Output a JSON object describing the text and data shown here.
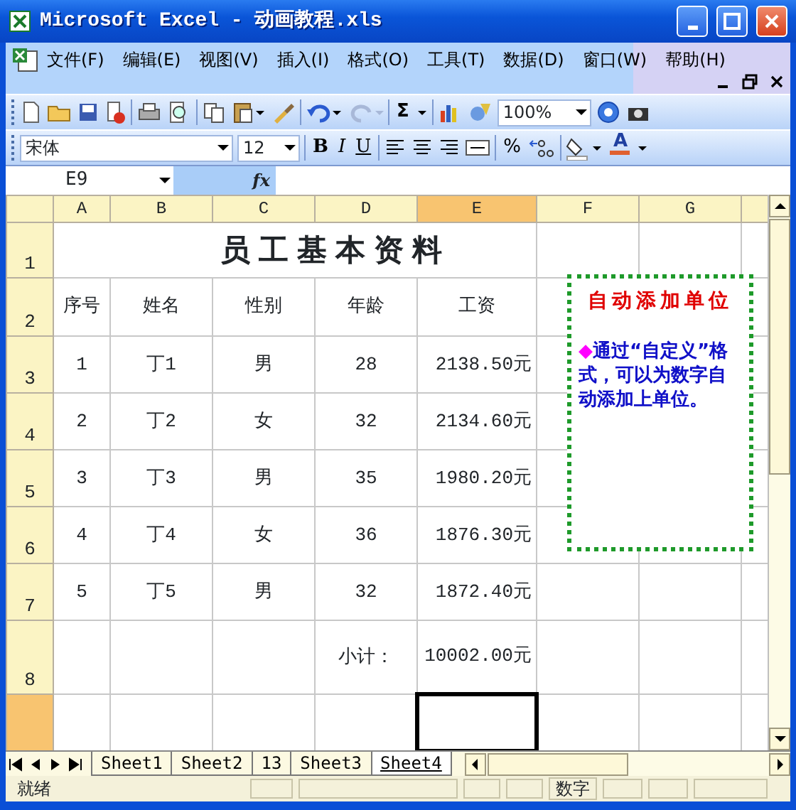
{
  "window": {
    "title": "Microsoft Excel - 动画教程.xls"
  },
  "menu": [
    "文件(F)",
    "编辑(E)",
    "视图(V)",
    "插入(I)",
    "格式(O)",
    "工具(T)",
    "数据(D)",
    "窗口(W)",
    "帮助(H)"
  ],
  "standard_toolbar": {
    "sum": "Σ",
    "zoom": "100%"
  },
  "format_toolbar": {
    "font": "宋体",
    "size": "12",
    "bold": "B",
    "italic": "I",
    "underline": "U",
    "percent": "%",
    "font_color": "A"
  },
  "formula_bar": {
    "name_box": "E9",
    "fx": "fx"
  },
  "sheet": {
    "columns": [
      {
        "label": "A",
        "selected": false
      },
      {
        "label": "B",
        "selected": false
      },
      {
        "label": "C",
        "selected": false
      },
      {
        "label": "D",
        "selected": false
      },
      {
        "label": "E",
        "selected": true
      },
      {
        "label": "F",
        "selected": false
      },
      {
        "label": "G",
        "selected": false
      }
    ],
    "rows": [
      {
        "kind": "title",
        "header": "1",
        "selected": false,
        "text": "员工基本资料"
      },
      {
        "kind": "data",
        "header": "2",
        "selected": false,
        "cells": [
          "序号",
          "姓名",
          "性别",
          "年龄",
          "工资"
        ]
      },
      {
        "kind": "data",
        "header": "3",
        "selected": false,
        "cells": [
          "1",
          "丁1",
          "男",
          "28",
          "2138.50元"
        ]
      },
      {
        "kind": "data",
        "header": "4",
        "selected": false,
        "cells": [
          "2",
          "丁2",
          "女",
          "32",
          "2134.60元"
        ]
      },
      {
        "kind": "data",
        "header": "5",
        "selected": false,
        "cells": [
          "3",
          "丁3",
          "男",
          "35",
          "1980.20元"
        ]
      },
      {
        "kind": "data",
        "header": "6",
        "selected": false,
        "cells": [
          "4",
          "丁4",
          "女",
          "36",
          "1876.30元"
        ]
      },
      {
        "kind": "data",
        "header": "7",
        "selected": false,
        "cells": [
          "5",
          "丁5",
          "男",
          "32",
          "1872.40元"
        ]
      },
      {
        "kind": "total",
        "header": "8",
        "selected": false,
        "label": "小计：",
        "value": "10002.00元"
      },
      {
        "kind": "blank",
        "selected": true
      }
    ]
  },
  "note": {
    "title": "自动添加单位",
    "bullet": "◆",
    "text": "通过“自定义”格式，可以为数字自动添加上单位。"
  },
  "sheet_tabs": [
    {
      "label": "Sheet1",
      "selected": false
    },
    {
      "label": "Sheet2",
      "selected": false
    },
    {
      "label": "13",
      "selected": false
    },
    {
      "label": "Sheet3",
      "selected": false
    },
    {
      "label": "Sheet4",
      "selected": true
    }
  ],
  "status_bar": {
    "mode": "就绪",
    "num_lock": "数字"
  }
}
